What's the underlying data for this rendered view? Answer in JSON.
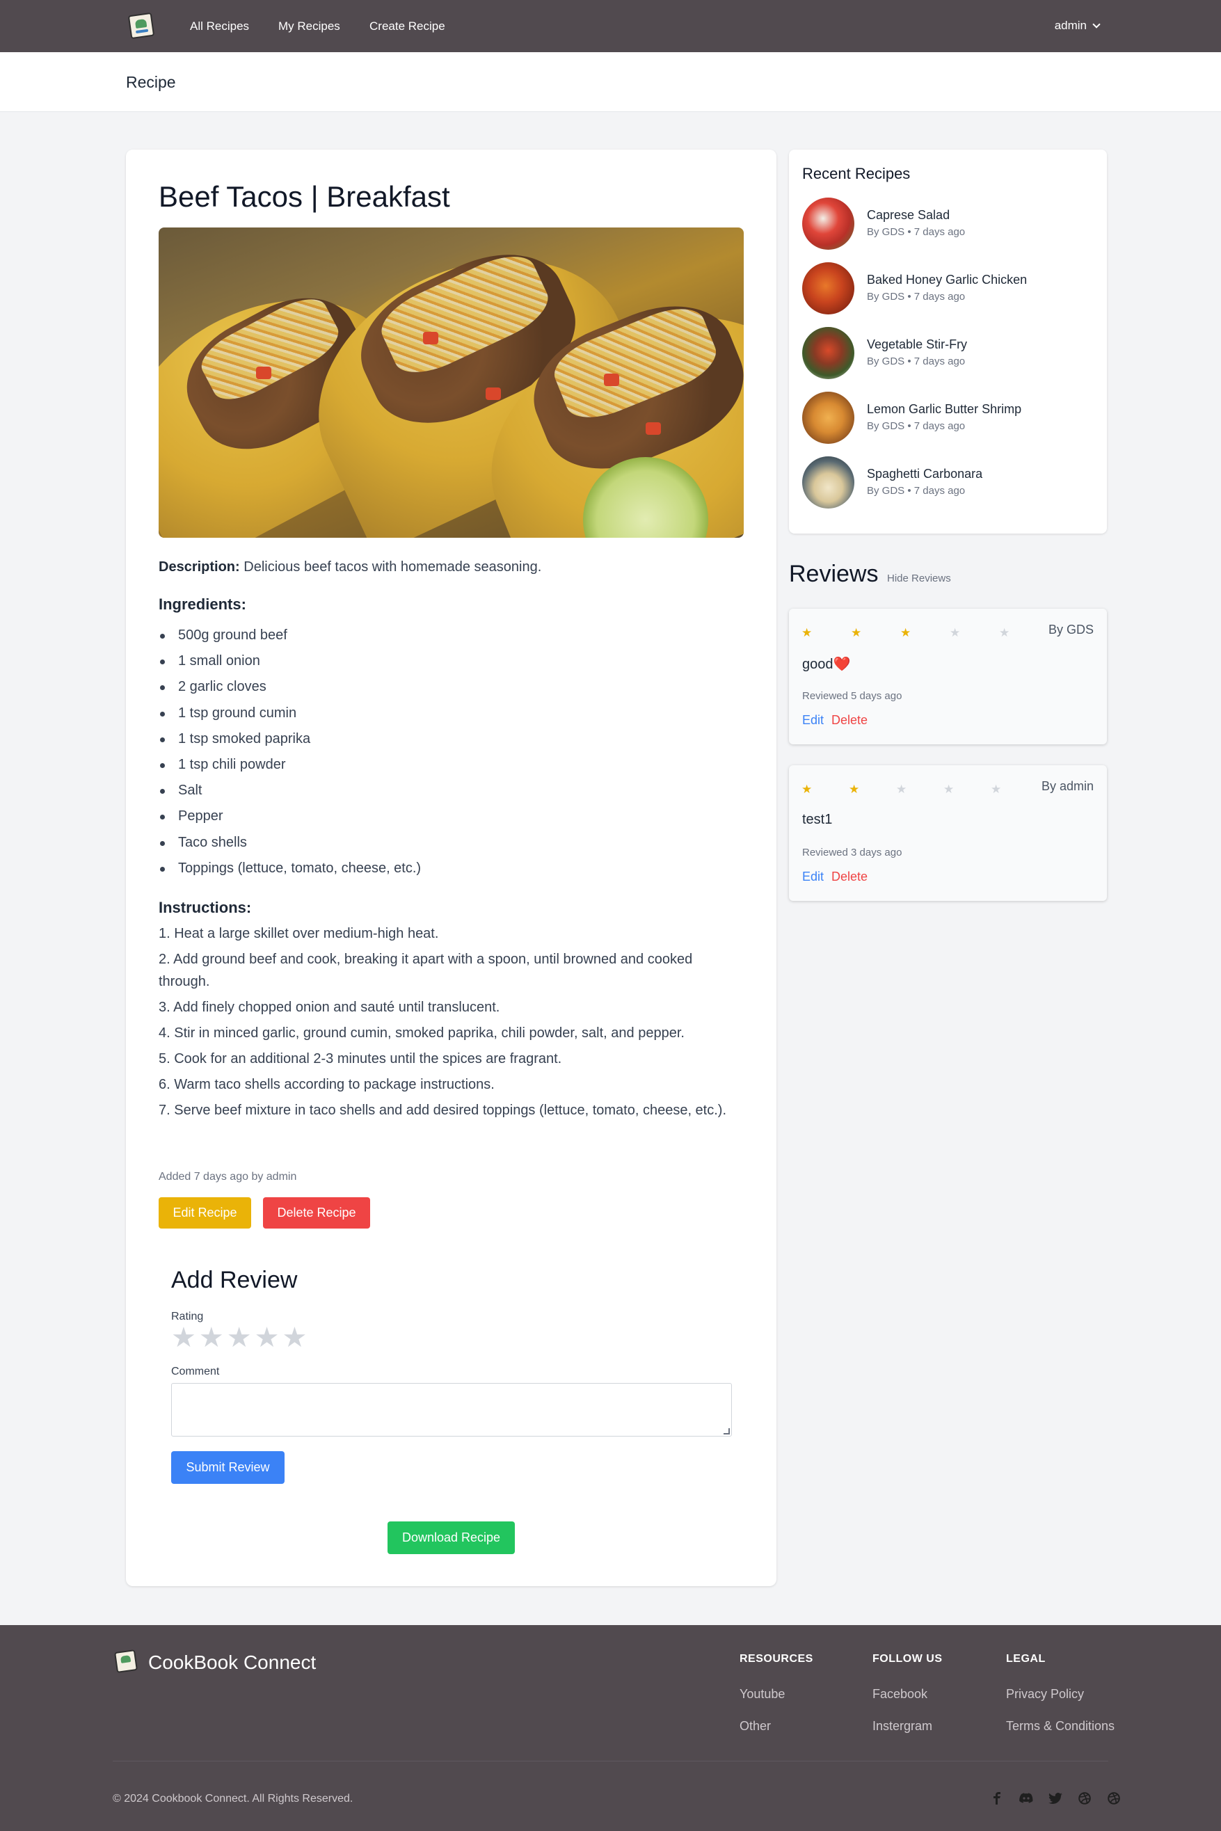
{
  "nav": {
    "links": [
      "All Recipes",
      "My Recipes",
      "Create Recipe"
    ],
    "user": "admin"
  },
  "header": {
    "title": "Recipe"
  },
  "recipe": {
    "title": "Beef Tacos | Breakfast",
    "description_label": "Description:",
    "description": "Delicious beef tacos with homemade seasoning.",
    "ingredients_heading": "Ingredients:",
    "ingredients": [
      "500g ground beef",
      "1 small onion",
      "2 garlic cloves",
      "1 tsp ground cumin",
      "1 tsp smoked paprika",
      "1 tsp chili powder",
      "Salt",
      "Pepper",
      "Taco shells",
      "Toppings (lettuce, tomato, cheese, etc.)"
    ],
    "instructions_heading": "Instructions:",
    "instructions": [
      "1. Heat a large skillet over medium-high heat.",
      "2. Add ground beef and cook, breaking it apart with a spoon, until browned and cooked through.",
      "3. Add finely chopped onion and sauté until translucent.",
      "4. Stir in minced garlic, ground cumin, smoked paprika, chili powder, salt, and pepper.",
      "5. Cook for an additional 2-3 minutes until the spices are fragrant.",
      "6. Warm taco shells according to package instructions.",
      "7. Serve beef mixture in taco shells and add desired toppings (lettuce, tomato, cheese, etc.)."
    ],
    "added": "Added 7 days ago by admin",
    "edit_label": "Edit Recipe",
    "delete_label": "Delete Recipe"
  },
  "add_review": {
    "heading": "Add Review",
    "rating_label": "Rating",
    "rating_value": 0,
    "comment_label": "Comment",
    "comment_value": "",
    "submit_label": "Submit Review"
  },
  "download_label": "Download Recipe",
  "recent": {
    "heading": "Recent Recipes",
    "items": [
      {
        "name": "Caprese Salad",
        "by": "By GDS • 7 days ago",
        "thumb_color": "#c9453a"
      },
      {
        "name": "Baked Honey Garlic Chicken",
        "by": "By GDS • 7 days ago",
        "thumb_color": "#b0341e"
      },
      {
        "name": "Vegetable Stir-Fry",
        "by": "By GDS • 7 days ago",
        "thumb_color": "#7a3b2c"
      },
      {
        "name": "Lemon Garlic Butter Shrimp",
        "by": "By GDS • 7 days ago",
        "thumb_color": "#c98a3a"
      },
      {
        "name": "Spaghetti Carbonara",
        "by": "By GDS • 7 days ago",
        "thumb_color": "#3a4a52"
      }
    ]
  },
  "reviews": {
    "heading": "Reviews",
    "hide_label": "Hide Reviews",
    "items": [
      {
        "rating": 3,
        "by": "By GDS",
        "comment": "good❤️",
        "date": "Reviewed 5 days ago",
        "edit": "Edit",
        "delete": "Delete"
      },
      {
        "rating": 2,
        "by": "By admin",
        "comment": "test1",
        "date": "Reviewed 3 days ago",
        "edit": "Edit",
        "delete": "Delete"
      }
    ]
  },
  "footer": {
    "brand": "CookBook Connect",
    "columns": [
      {
        "heading": "RESOURCES",
        "links": [
          "Youtube",
          "Other"
        ]
      },
      {
        "heading": "FOLLOW US",
        "links": [
          "Facebook",
          "Instergram"
        ]
      },
      {
        "heading": "LEGAL",
        "links": [
          "Privacy Policy",
          "Terms & Conditions"
        ]
      }
    ],
    "copyright": "© 2024 Cookbook Connect. All Rights Reserved.",
    "social_icons": [
      "facebook-icon",
      "discord-icon",
      "twitter-icon",
      "dribbble-icon",
      "dribbble-icon"
    ]
  },
  "colors": {
    "nav_bg": "#514a4f",
    "accent_yellow": "#eab308",
    "accent_red": "#ef4444",
    "accent_blue": "#3b82f6",
    "accent_green": "#22c55e"
  }
}
